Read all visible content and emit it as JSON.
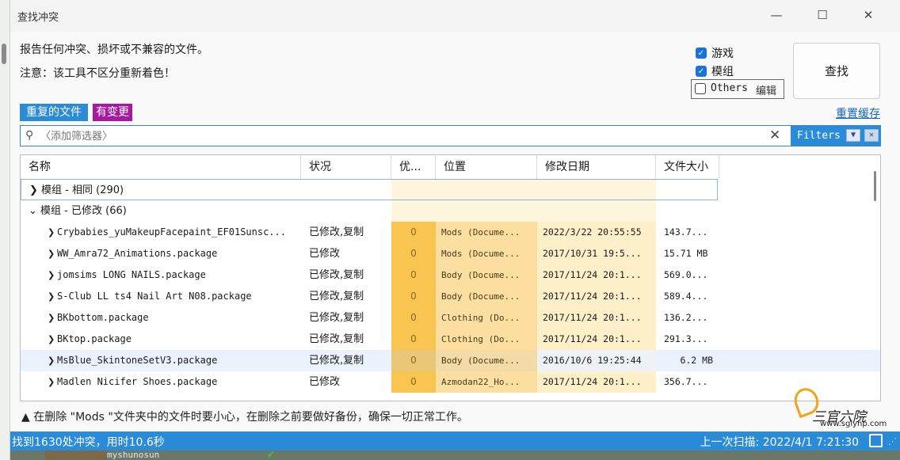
{
  "window": {
    "title": "查找冲突",
    "minimize": "—",
    "maximize": "☐",
    "close": "✕"
  },
  "header": {
    "line1": "报告任何冲突、损坏或不兼容的文件。",
    "line2": "注意：该工具不区分重新着色！"
  },
  "options": {
    "games": {
      "label": "游戏",
      "checked": true
    },
    "mods": {
      "label": "模组",
      "checked": true
    },
    "others": {
      "label": "Others",
      "checked": false,
      "edit_label": "编辑"
    }
  },
  "search_button": "查找",
  "tabs": {
    "duplicates": "重复的文件",
    "changed": "有变更"
  },
  "reset_cache": "重置缓存",
  "filter": {
    "placeholder": "〈添加筛选器〉",
    "filters_label": "Filters"
  },
  "table": {
    "columns": [
      "名称",
      "状况",
      "优...",
      "位置",
      "修改日期",
      "文件大小"
    ],
    "groups": [
      {
        "label": "模组 - 相同 (290)",
        "expanded": false
      },
      {
        "label": "模组 - 已修改 (66)",
        "expanded": true
      }
    ],
    "rows": [
      {
        "name": "Crybabies_yuMakeupFacepaint_EF01Sunsc...",
        "status": "已修改,复制",
        "priority": "0",
        "location": "Mods (Docume...",
        "date": "2022/3/22 20:55:55",
        "size": "143.7..."
      },
      {
        "name": "WW_Amra72_Animations.package",
        "status": "已修改",
        "priority": "0",
        "location": "Mods (Docume...",
        "date": "2017/10/31 19:5...",
        "size": "15.71 MB"
      },
      {
        "name": "jomsims LONG NAILS.package",
        "status": "已修改,复制",
        "priority": "0",
        "location": "Body (Docume...",
        "date": "2017/11/24 20:1...",
        "size": "569.0..."
      },
      {
        "name": "S-Club LL ts4 Nail Art N08.package",
        "status": "已修改,复制",
        "priority": "0",
        "location": "Body (Docume...",
        "date": "2017/11/24 20:1...",
        "size": "589.4..."
      },
      {
        "name": "BKbottom.package",
        "status": "已修改,复制",
        "priority": "0",
        "location": "Clothing (Do...",
        "date": "2017/11/24 20:1...",
        "size": "136.2..."
      },
      {
        "name": "BKtop.package",
        "status": "已修改,复制",
        "priority": "0",
        "location": "Clothing (Do...",
        "date": "2017/11/24 20:1...",
        "size": "291.3..."
      },
      {
        "name": "MsBlue_SkintoneSetV3.package",
        "status": "已修改,复制",
        "priority": "0",
        "location": "Body (Docume...",
        "date": "2016/10/6 19:25:44",
        "size": "6.2 MB"
      },
      {
        "name": "Madlen Nicifer Shoes.package",
        "status": "已修改",
        "priority": "0",
        "location": "Azmodan22_Ho...",
        "date": "2017/11/24 20:1...",
        "size": "356.7..."
      }
    ]
  },
  "warning": "在删除 \"Mods \"文件夹中的文件时要小心，在删除之前要做好备份，确保一切正常工作。",
  "status": {
    "left": "找到1630处冲突，用时10.6秒",
    "right": "上一次扫描: 2022/4/1 7:21:30"
  },
  "watermark": {
    "name": "三官六院",
    "url": "www.sglynp.com"
  },
  "background": {
    "username": "myshunosun"
  },
  "colors": {
    "accent": "#2a8bd8",
    "changed_tab": "#a51aa0",
    "priority": "#f9c450"
  }
}
